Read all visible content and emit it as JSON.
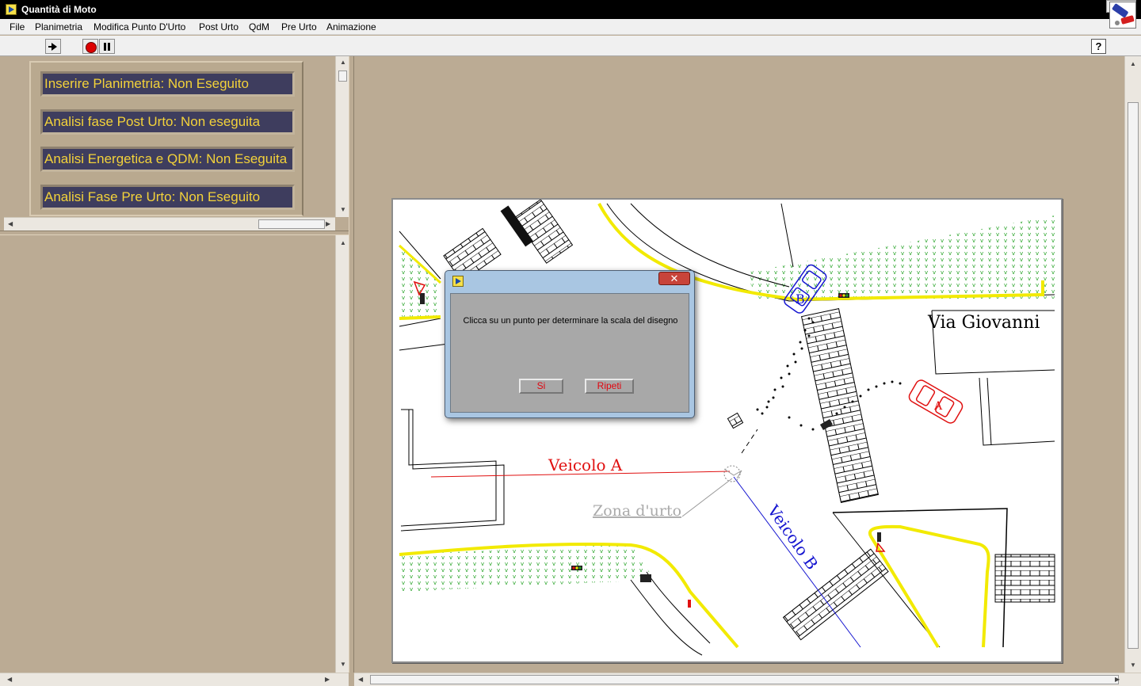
{
  "window": {
    "title": "Quantità di Moto",
    "close_glyph": "✕"
  },
  "menu": [
    "File",
    "Planimetria",
    "Modifica Punto D'Urto",
    "Post Urto",
    "QdM",
    "Pre Urto",
    "Animazione"
  ],
  "toolbar": {
    "help_glyph": "?"
  },
  "status_panel": {
    "items": [
      "Inserire Planimetria: Non Eseguito",
      "Analisi fase Post Urto: Non eseguita",
      "Analisi Energetica e QDM: Non Eseguita",
      "Analisi Fase Pre Urto: Non Eseguito"
    ],
    "color_text": "#f3d23a",
    "color_background": "#3e3d5e"
  },
  "drawing": {
    "street_label": "Via Giovanni",
    "vehicle_a_label": "Veicolo A",
    "vehicle_b_label": "Veicolo B",
    "impact_zone_label": "Zona d'urto",
    "vehicle_a_tag": "A",
    "vehicle_b_tag": "B",
    "color_vehicle_a": "#e01010",
    "color_vehicle_b": "#1515d0",
    "color_curb": "#f2ea00",
    "color_green_area": "#20a020"
  },
  "dialog": {
    "message": "Clicca su un punto per determinare la scala del disegno",
    "yes_label": "Si",
    "retry_label": "Ripeti",
    "close_glyph": "✕"
  }
}
